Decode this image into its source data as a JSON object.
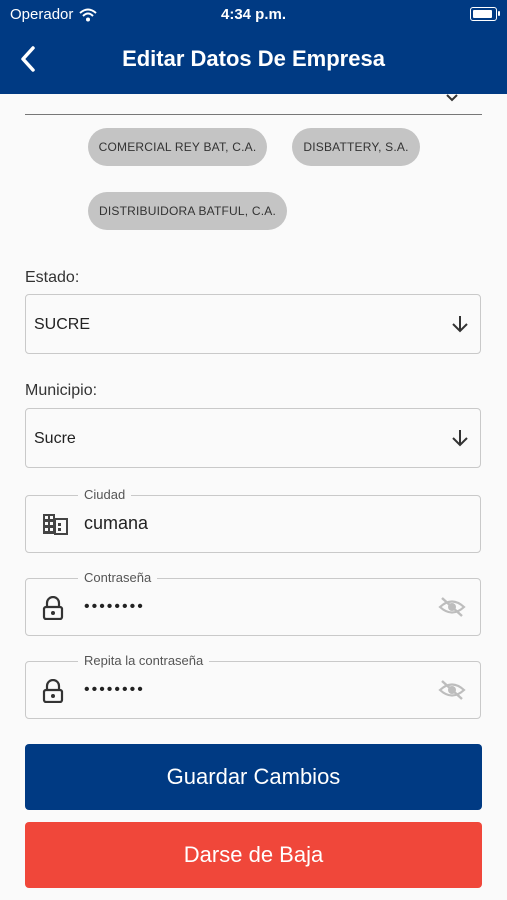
{
  "status_bar": {
    "carrier": "Operador",
    "time": "4:34 p.m."
  },
  "header": {
    "title": "Editar Datos De Empresa"
  },
  "chips": [
    "COMERCIAL REY BAT, C.A.",
    "DISBATTERY, S.A.",
    "DISTRIBUIDORA BATFUL, C.A."
  ],
  "estado": {
    "label": "Estado:",
    "value": "SUCRE"
  },
  "municipio": {
    "label": "Municipio:",
    "value": "Sucre"
  },
  "ciudad": {
    "label": "Ciudad",
    "value": "cumana"
  },
  "password": {
    "label": "Contraseña",
    "value": "••••••••"
  },
  "password_confirm": {
    "label": "Repita la contraseña",
    "value": "••••••••"
  },
  "buttons": {
    "save": "Guardar Cambios",
    "unsubscribe": "Darse de Baja"
  },
  "colors": {
    "primary": "#003a83",
    "danger": "#f0473a",
    "chip": "#c4c4c4"
  }
}
